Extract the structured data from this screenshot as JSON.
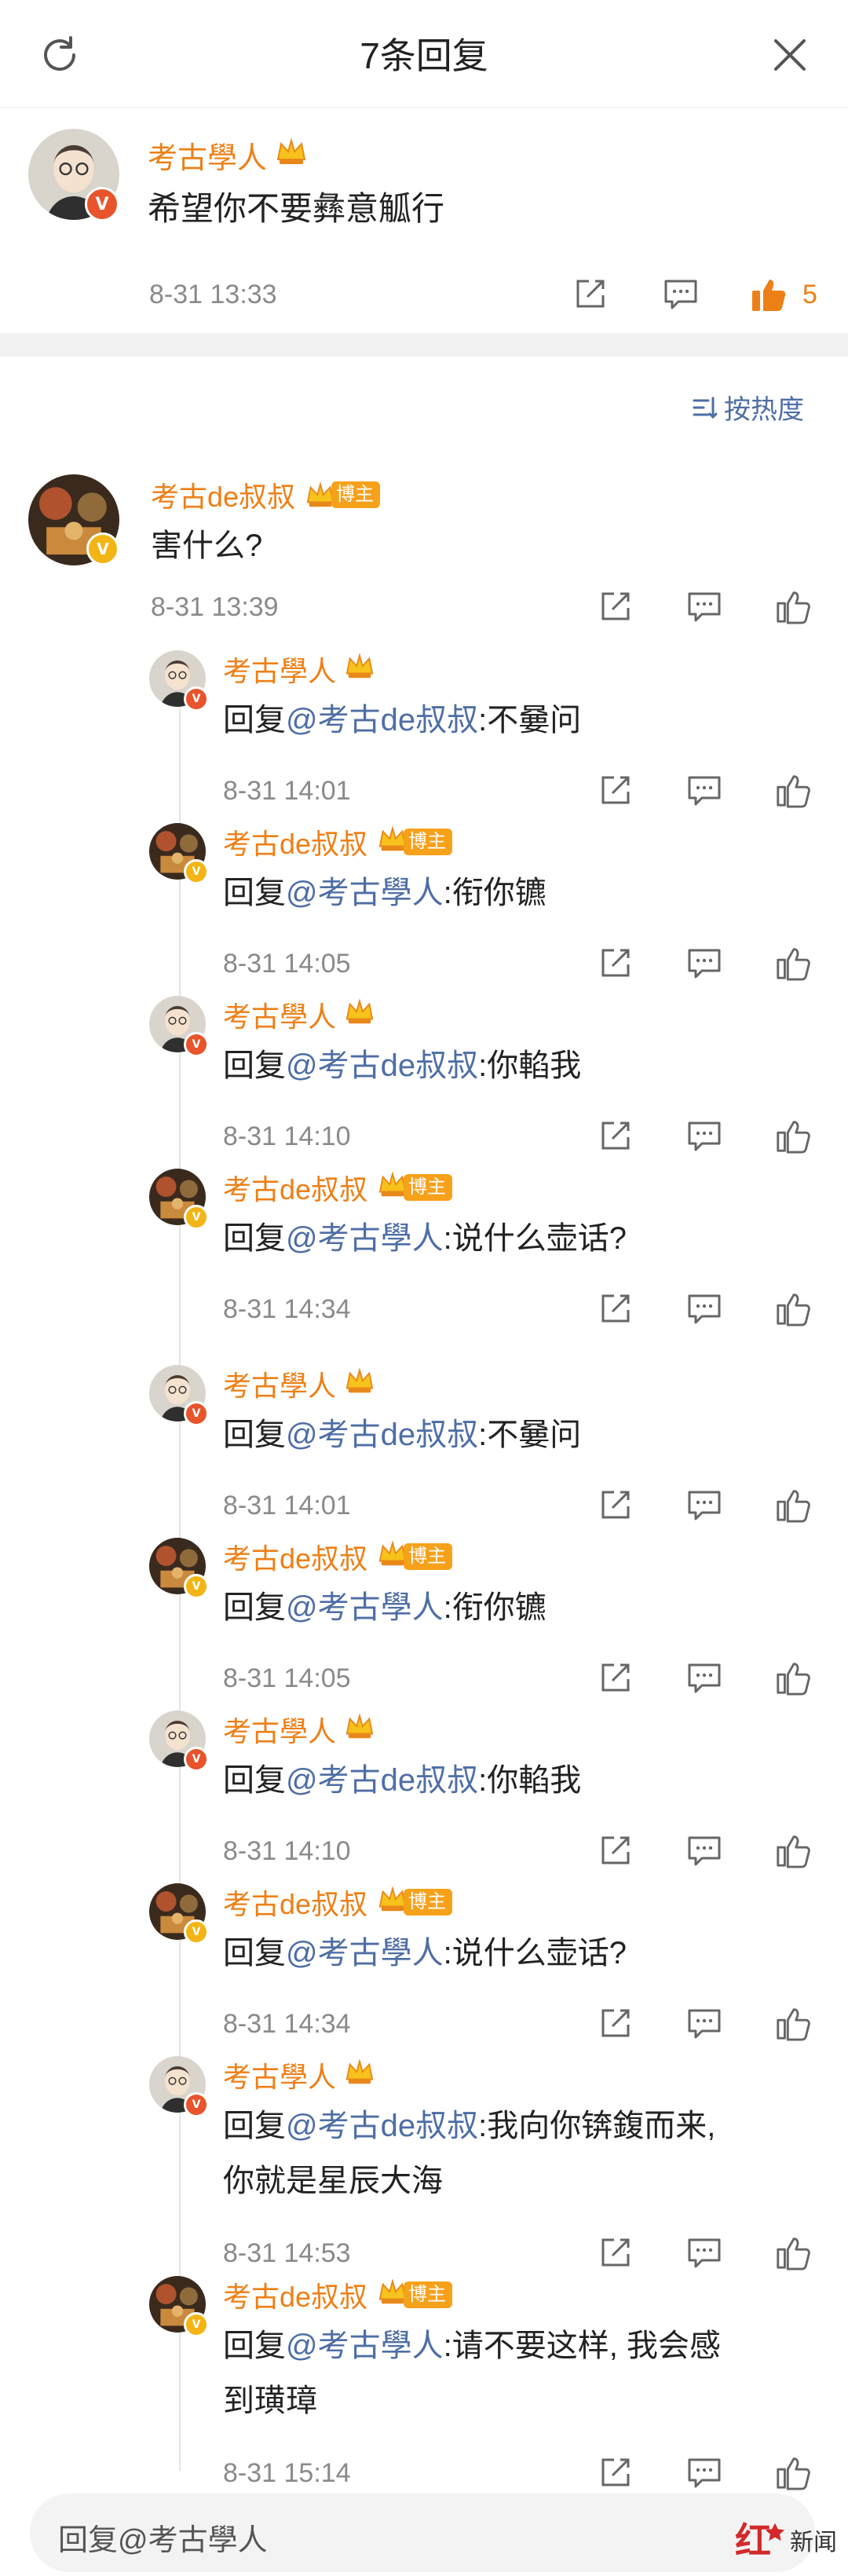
{
  "header": {
    "title": "7条回复"
  },
  "main_comment": {
    "user": "考古學人",
    "text": "希望你不要彝意觚行",
    "time": "8-31 13:33",
    "likes": "5"
  },
  "sort_label": "按热度",
  "root_reply": {
    "user": "考古de叔叔",
    "badge": "博主",
    "text": "害什么?",
    "time": "8-31 13:39"
  },
  "reply_prefix": "回复",
  "replies": [
    {
      "user": "考古學人",
      "at": "@考古de叔叔",
      "text": ":不嘦问",
      "time": "8-31 14:01"
    },
    {
      "user": "考古de叔叔",
      "badge": "博主",
      "at": "@考古學人",
      "text": ":衔你镳",
      "time": "8-31 14:05"
    },
    {
      "user": "考古學人",
      "at": "@考古de叔叔",
      "text": ":你輡我",
      "time": "8-31 14:10"
    },
    {
      "user": "考古de叔叔",
      "badge": "博主",
      "at": "@考古學人",
      "text": ":说什么壶话?",
      "time": "8-31 14:34"
    },
    {
      "user": "考古學人",
      "at": "@考古de叔叔",
      "text": ":不嘦问",
      "time": "8-31 14:01"
    },
    {
      "user": "考古de叔叔",
      "badge": "博主",
      "at": "@考古學人",
      "text": ":衔你镳",
      "time": "8-31 14:05"
    },
    {
      "user": "考古學人",
      "at": "@考古de叔叔",
      "text": ":你輡我",
      "time": "8-31 14:10"
    },
    {
      "user": "考古de叔叔",
      "badge": "博主",
      "at": "@考古學人",
      "text": ":说什么壶话?",
      "time": "8-31 14:34"
    },
    {
      "user": "考古學人",
      "at": "@考古de叔叔",
      "text": ":我向你锛鍑而来,",
      "text2": "你就是星辰大海",
      "time": "8-31 14:53"
    },
    {
      "user": "考古de叔叔",
      "badge": "博主",
      "at": "@考古學人",
      "text": ":请不要这样, 我会感",
      "text2": "到璜璋",
      "time": "8-31 15:14"
    }
  ],
  "bottom": {
    "placeholder": "回复@考古學人"
  },
  "watermark": {
    "brand": "红星新闻"
  },
  "icons": [
    "refresh-icon",
    "close-icon",
    "share-icon",
    "comment-icon",
    "like-icon",
    "crown-icon",
    "verified-icon",
    "sort-icon"
  ],
  "colors": {
    "username": "#ee7f16",
    "mention": "#4e6ea5",
    "liked": "#ee7f16",
    "timestamp": "#8a8a8a"
  }
}
